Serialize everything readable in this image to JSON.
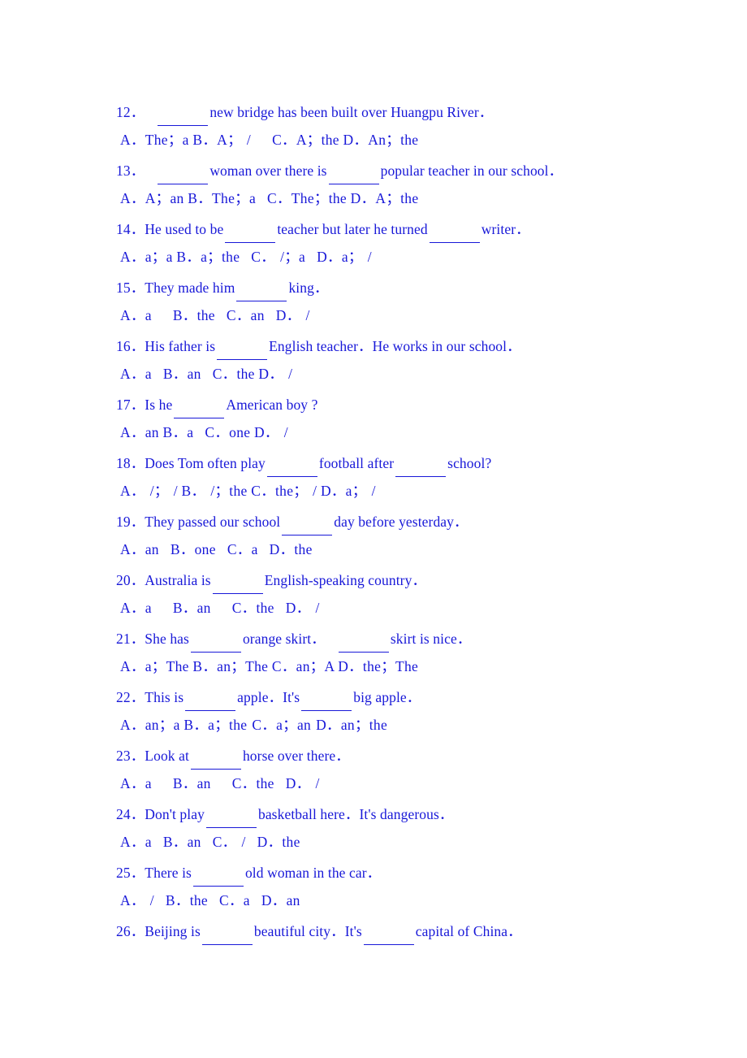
{
  "document": {
    "type": "worksheet",
    "subject": "English grammar — articles (a / an / the / zero article)",
    "text_color": "#1818D8",
    "background_color": "#FFFFFF",
    "page_range": "questions 12 to 26"
  },
  "questions": [
    {
      "number": "12．",
      "stem_parts": [
        "",
        "new bridge has been built over Huangpu River．"
      ],
      "options": "A．The；a B．A；  /      C．A；the  D．An；the"
    },
    {
      "number": "13．",
      "stem_parts": [
        "",
        "woman over there is",
        "popular teacher in our school．"
      ],
      "options": "A．A；an B．The；a    C．The；the D．A；the"
    },
    {
      "number": "14．",
      "stem_parts": [
        "He used to be",
        "teacher but later he turned",
        "writer．"
      ],
      "options": "A．a；a B．a；the    C．  /；a    D．a；  /"
    },
    {
      "number": "15．",
      "stem_parts": [
        "They made him",
        "king．"
      ],
      "options": "A．a     B．the    C．an   D．  /"
    },
    {
      "number": "16．",
      "stem_parts": [
        "His father is",
        "English teacher．He works in our school．"
      ],
      "options": "A．a    B．an    C．the  D．  /"
    },
    {
      "number": "17．",
      "stem_parts": [
        "Is he",
        "American boy ?"
      ],
      "options": "A．an  B．a    C．one  D．  /"
    },
    {
      "number": "18．",
      "stem_parts": [
        "Does Tom often play",
        "football after",
        "school?"
      ],
      "options": "A．  /；  /  B．  /；the  C．the；  /   D．a；  /"
    },
    {
      "number": "19．",
      "stem_parts": [
        "They passed our school",
        "day before yesterday．"
      ],
      "options": "A．an    B．one     C．a     D．the"
    },
    {
      "number": "20．",
      "stem_parts": [
        "Australia is",
        "English-speaking country．"
      ],
      "options": "A．a     B．an     C．the   D．  /"
    },
    {
      "number": "21．",
      "stem_parts": [
        "She has",
        "orange skirt．",
        "skirt is nice．"
      ],
      "options": "A．a；The B．an；The  C．an；A  D．the；The"
    },
    {
      "number": "22．",
      "stem_parts": [
        "This is",
        "apple．It's",
        "big apple．"
      ],
      "options": "A．an；a B．a；the   C．a；an   D．an；the"
    },
    {
      "number": "23．",
      "stem_parts": [
        "Look at",
        "horse over there．"
      ],
      "options": "A．a     B．an     C．the    D．  /"
    },
    {
      "number": "24．",
      "stem_parts": [
        "Don't play",
        "basketball here．It's dangerous．"
      ],
      "options": "A．a    B．an    C．  /     D．the"
    },
    {
      "number": "25．",
      "stem_parts": [
        "There is",
        "old woman in the car．"
      ],
      "options": "A．  /    B．the    C．a     D．an"
    },
    {
      "number": "26．",
      "stem_parts": [
        "Beijing is",
        "beautiful city．It's",
        "capital of China．"
      ],
      "options": null
    }
  ],
  "lines": [
    {
      "kind": "question",
      "id": "q12",
      "segments": [
        {
          "t": "text",
          "v": "12．"
        },
        {
          "t": "gap",
          "v": "md"
        },
        {
          "t": "blank"
        },
        {
          "t": "text",
          "v": "new bridge has been built over Huangpu River．"
        }
      ]
    },
    {
      "kind": "options",
      "id": "o12",
      "segments": [
        {
          "t": "text",
          "v": "A．The；a B．A；"
        },
        {
          "t": "gap",
          "v": "sm"
        },
        {
          "t": "text",
          "v": "/"
        },
        {
          "t": "gap",
          "v": "lg"
        },
        {
          "t": "text",
          "v": "C．A；the  D．An；the"
        }
      ]
    },
    {
      "kind": "question",
      "id": "q13",
      "segments": [
        {
          "t": "text",
          "v": "13．"
        },
        {
          "t": "gap",
          "v": "md"
        },
        {
          "t": "blank"
        },
        {
          "t": "text",
          "v": "woman over there is"
        },
        {
          "t": "blank"
        },
        {
          "t": "text",
          "v": "popular teacher in our school．"
        }
      ]
    },
    {
      "kind": "options",
      "id": "o13",
      "segments": [
        {
          "t": "text",
          "v": "A．A；an B．The；a"
        },
        {
          "t": "gap",
          "v": "md"
        },
        {
          "t": "text",
          "v": "C．The；the D．A；the"
        }
      ]
    },
    {
      "kind": "question",
      "id": "q14",
      "segments": [
        {
          "t": "text",
          "v": "14．He used to be"
        },
        {
          "t": "blank"
        },
        {
          "t": "text",
          "v": "teacher but later he turned"
        },
        {
          "t": "blank"
        },
        {
          "t": "text",
          "v": "writer．"
        }
      ]
    },
    {
      "kind": "options",
      "id": "o14",
      "segments": [
        {
          "t": "text",
          "v": "A．a；a B．a；the"
        },
        {
          "t": "gap",
          "v": "md"
        },
        {
          "t": "text",
          "v": "C．"
        },
        {
          "t": "gap",
          "v": "sm"
        },
        {
          "t": "text",
          "v": "/；a"
        },
        {
          "t": "gap",
          "v": "md"
        },
        {
          "t": "text",
          "v": "D．a；"
        },
        {
          "t": "gap",
          "v": "sm"
        },
        {
          "t": "text",
          "v": "/"
        }
      ]
    },
    {
      "kind": "question",
      "id": "q15",
      "segments": [
        {
          "t": "text",
          "v": "15．They made him"
        },
        {
          "t": "blank"
        },
        {
          "t": "text",
          "v": "king．"
        }
      ]
    },
    {
      "kind": "options",
      "id": "o15",
      "segments": [
        {
          "t": "text",
          "v": "A．a"
        },
        {
          "t": "gap",
          "v": "lg"
        },
        {
          "t": "text",
          "v": "B．the"
        },
        {
          "t": "gap",
          "v": "md"
        },
        {
          "t": "text",
          "v": "C．an"
        },
        {
          "t": "gap",
          "v": "md"
        },
        {
          "t": "text",
          "v": "D．"
        },
        {
          "t": "gap",
          "v": "sm"
        },
        {
          "t": "text",
          "v": "/"
        }
      ]
    },
    {
      "kind": "question",
      "id": "q16",
      "segments": [
        {
          "t": "text",
          "v": "16．His father is"
        },
        {
          "t": "blank"
        },
        {
          "t": "text",
          "v": "English teacher．He works in our school．"
        }
      ]
    },
    {
      "kind": "options",
      "id": "o16",
      "segments": [
        {
          "t": "text",
          "v": "A．a"
        },
        {
          "t": "gap",
          "v": "md"
        },
        {
          "t": "text",
          "v": "B．an"
        },
        {
          "t": "gap",
          "v": "md"
        },
        {
          "t": "text",
          "v": "C．the  D．"
        },
        {
          "t": "gap",
          "v": "sm"
        },
        {
          "t": "text",
          "v": "/"
        }
      ]
    },
    {
      "kind": "question",
      "id": "q17",
      "segments": [
        {
          "t": "text",
          "v": "17．Is he"
        },
        {
          "t": "blank"
        },
        {
          "t": "text",
          "v": "American boy ?"
        }
      ]
    },
    {
      "kind": "options",
      "id": "o17",
      "segments": [
        {
          "t": "text",
          "v": "A．an  B．a"
        },
        {
          "t": "gap",
          "v": "md"
        },
        {
          "t": "text",
          "v": "C．one  D．"
        },
        {
          "t": "gap",
          "v": "sm"
        },
        {
          "t": "text",
          "v": "/"
        }
      ]
    },
    {
      "kind": "question",
      "id": "q18",
      "segments": [
        {
          "t": "text",
          "v": "18．Does Tom often play"
        },
        {
          "t": "blank"
        },
        {
          "t": "text",
          "v": "football after"
        },
        {
          "t": "blank"
        },
        {
          "t": "text",
          "v": "school?"
        }
      ]
    },
    {
      "kind": "options",
      "id": "o18",
      "segments": [
        {
          "t": "text",
          "v": "A．"
        },
        {
          "t": "gap",
          "v": "sm"
        },
        {
          "t": "text",
          "v": "/；"
        },
        {
          "t": "gap",
          "v": "sm"
        },
        {
          "t": "text",
          "v": "/ B．"
        },
        {
          "t": "gap",
          "v": "sm"
        },
        {
          "t": "text",
          "v": "/；the C．the；"
        },
        {
          "t": "gap",
          "v": "sm"
        },
        {
          "t": "text",
          "v": "/  D．a；"
        },
        {
          "t": "gap",
          "v": "sm"
        },
        {
          "t": "text",
          "v": "/"
        }
      ]
    },
    {
      "kind": "question",
      "id": "q19",
      "segments": [
        {
          "t": "text",
          "v": "19．They passed our school"
        },
        {
          "t": "blank"
        },
        {
          "t": "text",
          "v": "day before yesterday．"
        }
      ]
    },
    {
      "kind": "options",
      "id": "o19",
      "segments": [
        {
          "t": "text",
          "v": "A．an"
        },
        {
          "t": "gap",
          "v": "md"
        },
        {
          "t": "text",
          "v": "B．one"
        },
        {
          "t": "gap",
          "v": "md"
        },
        {
          "t": "text",
          "v": "C．a"
        },
        {
          "t": "gap",
          "v": "md"
        },
        {
          "t": "text",
          "v": "D．the"
        }
      ]
    },
    {
      "kind": "question",
      "id": "q20",
      "segments": [
        {
          "t": "text",
          "v": "20．Australia is"
        },
        {
          "t": "blank"
        },
        {
          "t": "text",
          "v": "English-speaking country．"
        }
      ]
    },
    {
      "kind": "options",
      "id": "o20",
      "segments": [
        {
          "t": "text",
          "v": "A．a"
        },
        {
          "t": "gap",
          "v": "lg"
        },
        {
          "t": "text",
          "v": "B．an"
        },
        {
          "t": "gap",
          "v": "lg"
        },
        {
          "t": "text",
          "v": "C．the"
        },
        {
          "t": "gap",
          "v": "md"
        },
        {
          "t": "text",
          "v": "D．"
        },
        {
          "t": "gap",
          "v": "sm"
        },
        {
          "t": "text",
          "v": "/"
        }
      ]
    },
    {
      "kind": "question",
      "id": "q21",
      "segments": [
        {
          "t": "text",
          "v": "21．She has"
        },
        {
          "t": "blank"
        },
        {
          "t": "text",
          "v": "orange skirt．"
        },
        {
          "t": "gap",
          "v": "md"
        },
        {
          "t": "blank"
        },
        {
          "t": "text",
          "v": "skirt is nice．"
        }
      ]
    },
    {
      "kind": "options",
      "id": "o21",
      "segments": [
        {
          "t": "text",
          "v": "A．a；The B．an；The C．an；A D．the；The"
        }
      ]
    },
    {
      "kind": "question",
      "id": "q22",
      "segments": [
        {
          "t": "text",
          "v": "22．This is"
        },
        {
          "t": "blank"
        },
        {
          "t": "text",
          "v": "apple．It's"
        },
        {
          "t": "blank"
        },
        {
          "t": "text",
          "v": "big apple．"
        }
      ]
    },
    {
      "kind": "options",
      "id": "o22",
      "segments": [
        {
          "t": "text",
          "v": "A．an；a B．a；the"
        },
        {
          "t": "gap",
          "v": "sm"
        },
        {
          "t": "text",
          "v": "C．a；an"
        },
        {
          "t": "gap",
          "v": "sm"
        },
        {
          "t": "text",
          "v": "D．an；the"
        }
      ]
    },
    {
      "kind": "question",
      "id": "q23",
      "segments": [
        {
          "t": "text",
          "v": "23．Look at"
        },
        {
          "t": "blank"
        },
        {
          "t": "text",
          "v": "horse over there．"
        }
      ]
    },
    {
      "kind": "options",
      "id": "o23",
      "segments": [
        {
          "t": "text",
          "v": "A．a"
        },
        {
          "t": "gap",
          "v": "lg"
        },
        {
          "t": "text",
          "v": "B．an"
        },
        {
          "t": "gap",
          "v": "lg"
        },
        {
          "t": "text",
          "v": "C．the"
        },
        {
          "t": "gap",
          "v": "md"
        },
        {
          "t": "text",
          "v": "D．"
        },
        {
          "t": "gap",
          "v": "sm"
        },
        {
          "t": "text",
          "v": "/"
        }
      ]
    },
    {
      "kind": "question",
      "id": "q24",
      "segments": [
        {
          "t": "text",
          "v": "24．Don't play"
        },
        {
          "t": "blank"
        },
        {
          "t": "text",
          "v": "basketball here．It's dangerous．"
        }
      ]
    },
    {
      "kind": "options",
      "id": "o24",
      "segments": [
        {
          "t": "text",
          "v": "A．a"
        },
        {
          "t": "gap",
          "v": "md"
        },
        {
          "t": "text",
          "v": "B．an"
        },
        {
          "t": "gap",
          "v": "md"
        },
        {
          "t": "text",
          "v": "C．"
        },
        {
          "t": "gap",
          "v": "sm"
        },
        {
          "t": "text",
          "v": "/"
        },
        {
          "t": "gap",
          "v": "md"
        },
        {
          "t": "text",
          "v": "D．the"
        }
      ]
    },
    {
      "kind": "question",
      "id": "q25",
      "segments": [
        {
          "t": "text",
          "v": "25．There is"
        },
        {
          "t": "blank"
        },
        {
          "t": "text",
          "v": "old woman in the car．"
        }
      ]
    },
    {
      "kind": "options",
      "id": "o25",
      "segments": [
        {
          "t": "text",
          "v": "A．"
        },
        {
          "t": "gap",
          "v": "sm"
        },
        {
          "t": "text",
          "v": "/"
        },
        {
          "t": "gap",
          "v": "md"
        },
        {
          "t": "text",
          "v": "B．the"
        },
        {
          "t": "gap",
          "v": "md"
        },
        {
          "t": "text",
          "v": "C．a"
        },
        {
          "t": "gap",
          "v": "md"
        },
        {
          "t": "text",
          "v": "D．an"
        }
      ]
    },
    {
      "kind": "question",
      "id": "q26",
      "segments": [
        {
          "t": "text",
          "v": "26．Beijing is"
        },
        {
          "t": "blank"
        },
        {
          "t": "text",
          "v": "beautiful city．It's"
        },
        {
          "t": "blank"
        },
        {
          "t": "text",
          "v": "capital of China．"
        }
      ]
    }
  ]
}
